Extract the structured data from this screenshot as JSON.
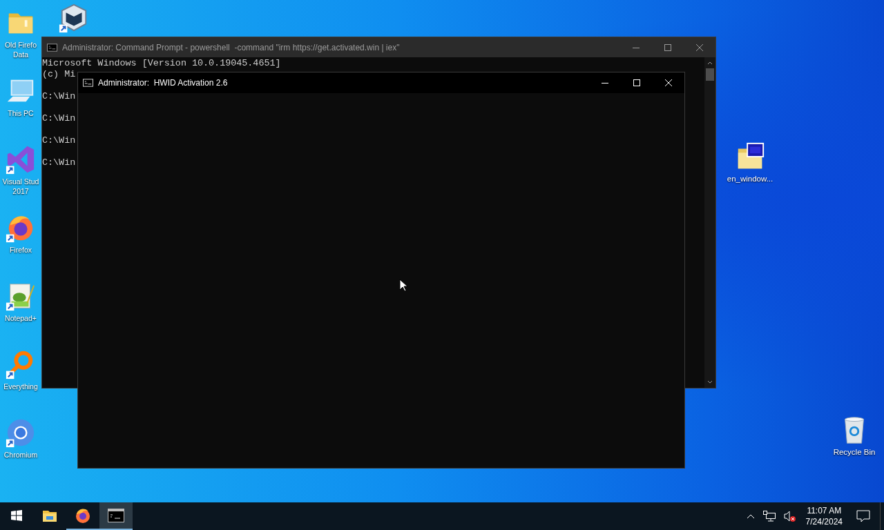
{
  "desktop": {
    "left_icons": [
      {
        "kind": "folder",
        "label": "Old Firefo\nData",
        "shortcut": false
      },
      {
        "kind": "computer",
        "label": "This PC",
        "shortcut": false
      },
      {
        "kind": "visual-studio",
        "label": "Visual Stud\n2017",
        "shortcut": true
      },
      {
        "kind": "firefox",
        "label": "Firefox",
        "shortcut": true
      },
      {
        "kind": "notepad",
        "label": "Notepad+",
        "shortcut": true
      },
      {
        "kind": "everything",
        "label": "Everything",
        "shortcut": true
      },
      {
        "kind": "chromium",
        "label": "Chromium",
        "shortcut": true
      }
    ],
    "partly_hidden_icons": [
      {
        "kind": "virtualbox",
        "shortcut": true
      }
    ],
    "right_icons": [
      {
        "kind": "iso",
        "label": "en_window...",
        "shortcut": false
      },
      {
        "kind": "recycle-bin",
        "label": "Recycle Bin",
        "shortcut": false
      }
    ]
  },
  "windows": [
    {
      "title": "Administrator: Command Prompt - powershell  -command \"irm https://get.activated.win | iex\"",
      "active": false,
      "scrollbar": true,
      "lines": [
        "Microsoft Windows [Version 10.0.19045.4651]",
        "(c) Mi",
        "C:\\Win",
        "C:\\Win",
        "C:\\Win",
        "C:\\Win"
      ]
    },
    {
      "title": "Administrator:  HWID Activation 2.6",
      "active": true,
      "scrollbar": false
    }
  ],
  "taskbar": {
    "apps": [
      {
        "kind": "explorer",
        "running": false,
        "selected": false
      },
      {
        "kind": "firefox",
        "running": true,
        "selected": false
      },
      {
        "kind": "terminal",
        "running": true,
        "selected": true
      }
    ],
    "clock": {
      "time": "11:07 AM",
      "date": "7/24/2024"
    }
  }
}
